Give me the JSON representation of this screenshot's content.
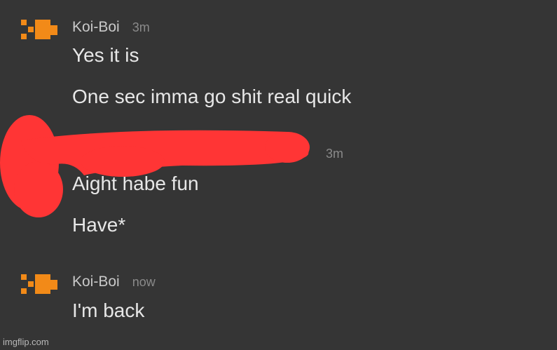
{
  "colors": {
    "background": "#353535",
    "avatar": "#f28a18",
    "redaction": "#ff3535"
  },
  "messages": [
    {
      "username": "Koi-Boi",
      "time": "3m",
      "lines": [
        "Yes it is",
        "One sec imma go shit real quick"
      ],
      "avatar_icon": "orange-pixel-fish-icon"
    },
    {
      "username": "",
      "time": "3m",
      "lines": [
        "Aight habe fun",
        "Have*"
      ],
      "avatar_icon": "redacted"
    },
    {
      "username": "Koi-Boi",
      "time": "now",
      "lines": [
        "I'm back"
      ],
      "avatar_icon": "orange-pixel-fish-icon"
    }
  ],
  "watermark": "imgflip.com"
}
